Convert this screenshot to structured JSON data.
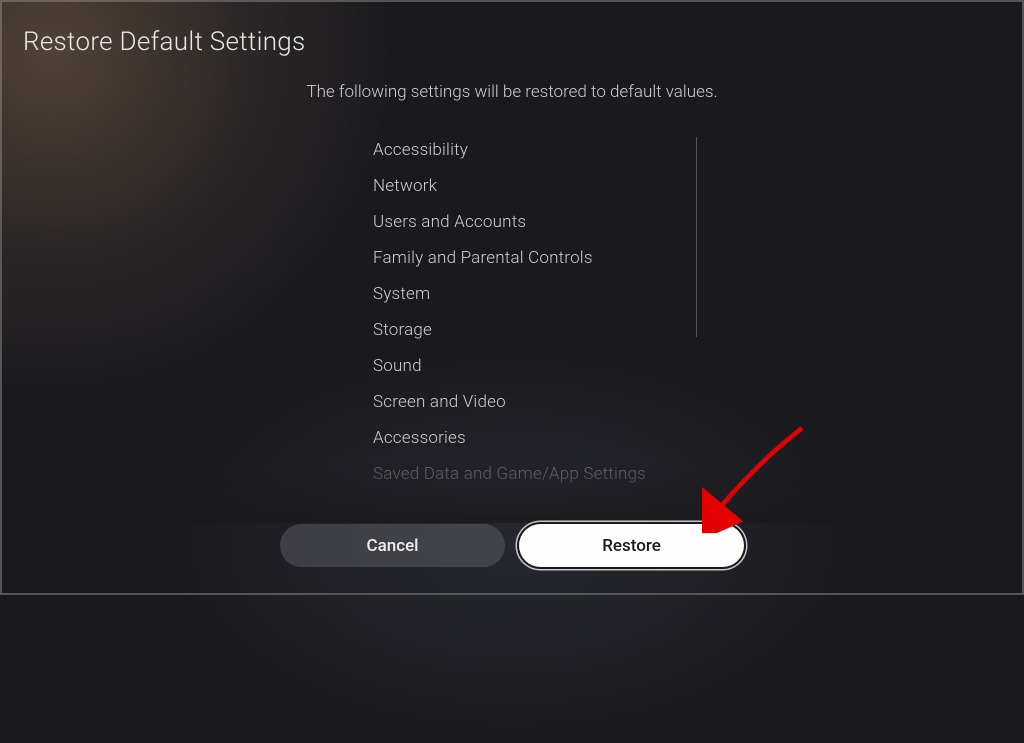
{
  "title": "Restore Default Settings",
  "description": "The following settings will be restored to default values.",
  "settings": [
    "Accessibility",
    "Network",
    "Users and Accounts",
    "Family and Parental Controls",
    "System",
    "Storage",
    "Sound",
    "Screen and Video",
    "Accessories",
    "Saved Data and Game/App Settings"
  ],
  "buttons": {
    "cancel": "Cancel",
    "restore": "Restore"
  }
}
